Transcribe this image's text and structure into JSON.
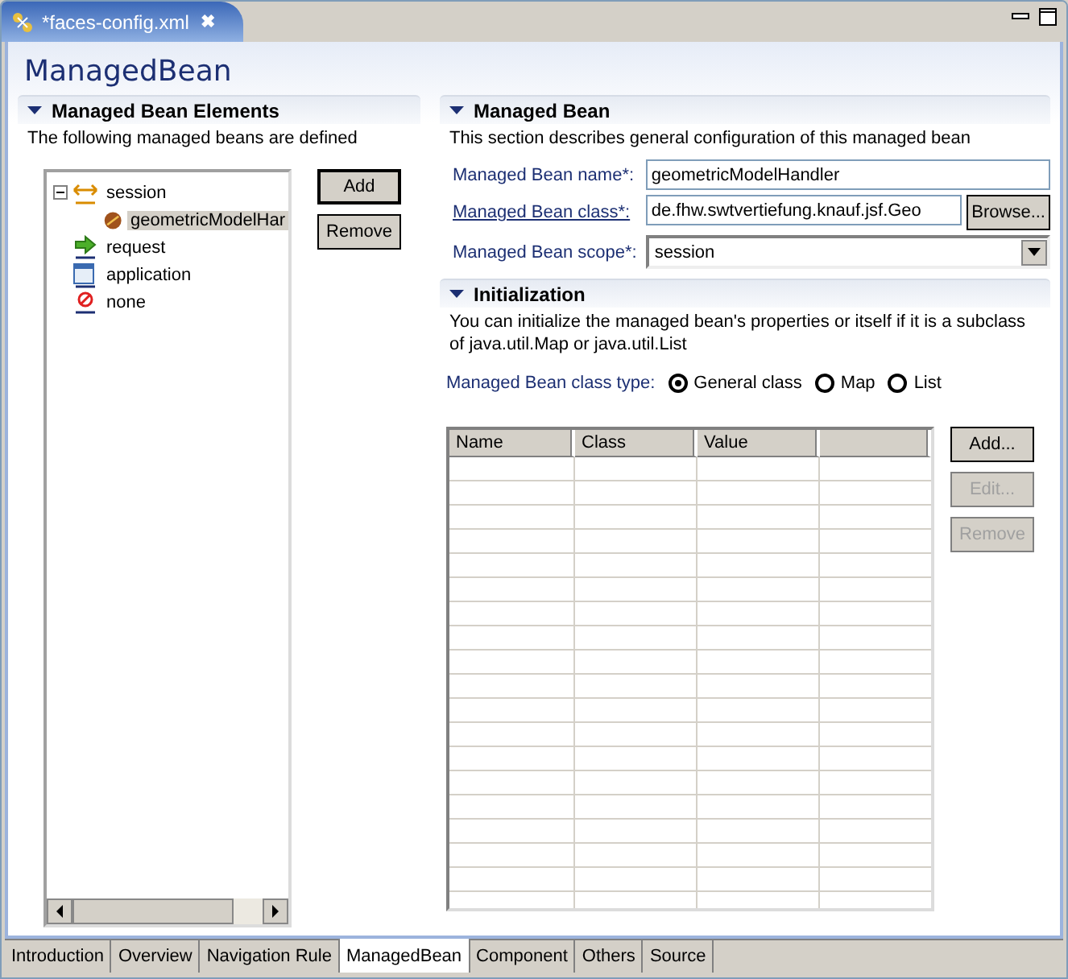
{
  "editor_tab": {
    "title": "*faces-config.xml",
    "close": "✖"
  },
  "page_title": "ManagedBean",
  "elements_section": {
    "title": "Managed Bean Elements",
    "expanded": true,
    "description": "The following managed beans are defined",
    "tree": [
      {
        "label": "session",
        "kind": "session",
        "expanded": true,
        "selected": false,
        "children": [
          {
            "label": "geometricModelHar",
            "kind": "bean",
            "selected": true
          }
        ]
      },
      {
        "label": "request",
        "kind": "request",
        "selected": false
      },
      {
        "label": "application",
        "kind": "application",
        "selected": false
      },
      {
        "label": "none",
        "kind": "none",
        "selected": false
      }
    ],
    "buttons": [
      {
        "label": "Add",
        "default": true
      },
      {
        "label": "Remove",
        "default": false
      }
    ]
  },
  "bean_section": {
    "title": "Managed Bean",
    "expanded": true,
    "description": "This section describes general configuration of this managed bean",
    "name_label": "Managed Bean name*:",
    "name_value": "geometricModelHandler",
    "class_label": "Managed Bean class*:",
    "class_value": "de.fhw.swtvertiefung.knauf.jsf.Geo",
    "browse": "Browse...",
    "scope_label": "Managed Bean scope*:",
    "scope_value": "session"
  },
  "init_section": {
    "title": "Initialization",
    "expanded": true,
    "description": "You can initialize the managed bean's properties or itself if it is a subclass of java.util.Map or java.util.List",
    "type_label": "Managed Bean class type:",
    "types": [
      {
        "label": "General class",
        "selected": true
      },
      {
        "label": "Map",
        "selected": false
      },
      {
        "label": "List",
        "selected": false
      }
    ],
    "table": {
      "columns": [
        "Name",
        "Class",
        "Value"
      ]
    },
    "buttons": [
      {
        "label": "Add...",
        "disabled": false
      },
      {
        "label": "Edit...",
        "disabled": true
      },
      {
        "label": "Remove",
        "disabled": true
      }
    ]
  },
  "page_tabs": [
    {
      "label": "Introduction",
      "selected": false
    },
    {
      "label": "Overview",
      "selected": false
    },
    {
      "label": "Navigation Rule",
      "selected": false
    },
    {
      "label": "ManagedBean",
      "selected": true
    },
    {
      "label": "Component",
      "selected": false
    },
    {
      "label": "Others",
      "selected": false
    },
    {
      "label": "Source",
      "selected": false
    }
  ]
}
